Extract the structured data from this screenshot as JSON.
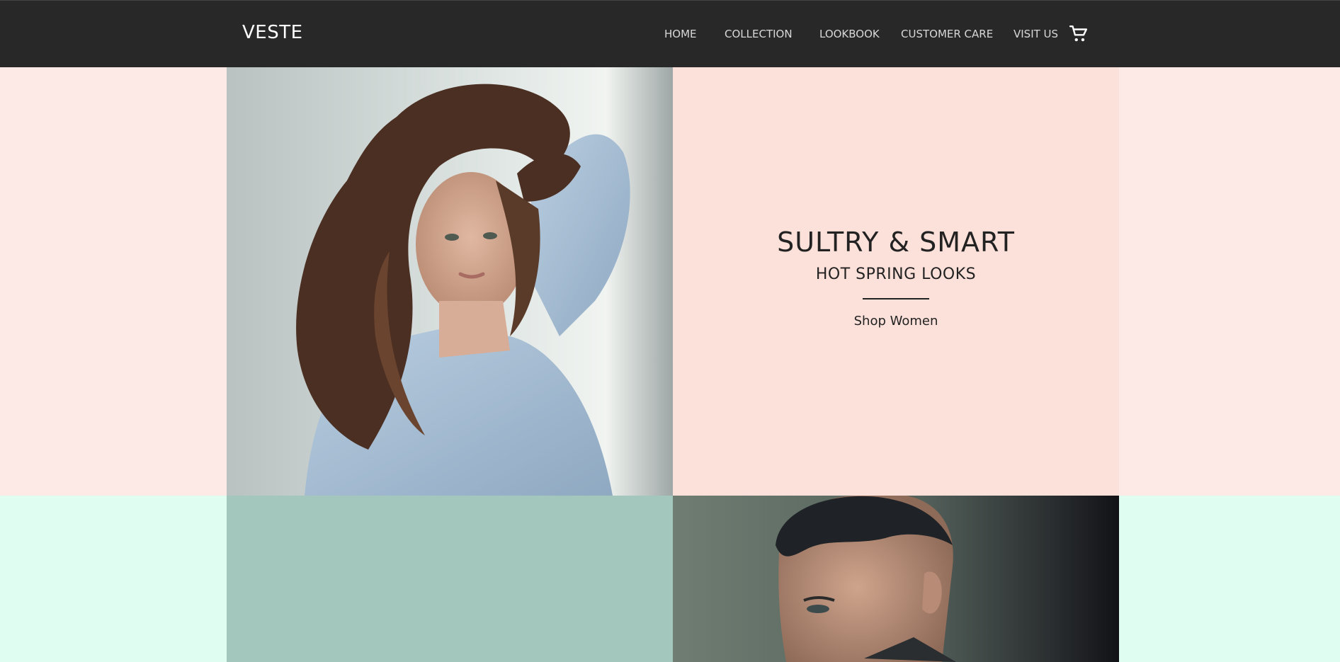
{
  "brand": {
    "logo": "VESTE"
  },
  "nav": {
    "items": [
      {
        "label": "HOME"
      },
      {
        "label": "COLLECTION"
      },
      {
        "label": "LOOKBOOK"
      },
      {
        "label": "CUSTOMER CARE"
      },
      {
        "label": "VISIT US"
      }
    ],
    "cart_icon": "shopping-cart-icon"
  },
  "promo": {
    "title": "SULTRY & SMART",
    "subtitle": "HOT SPRING LOOKS",
    "link": "Shop Women"
  },
  "colors": {
    "header_bg": "#282828",
    "top_band_bg": "#fde9e6",
    "promo_panel_bg": "#fce0da",
    "bottom_band_bg": "#dffdf0",
    "teal_panel_bg": "#a3c7bd"
  }
}
